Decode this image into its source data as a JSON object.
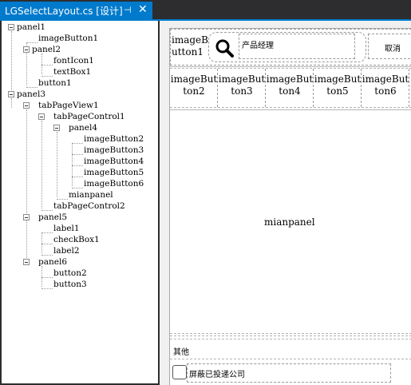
{
  "tab": {
    "title": "LGSelectLayout.cs [设计]",
    "pin_icon": "pin-icon",
    "close_icon": "close-icon"
  },
  "tree": {
    "panel1": "panel1",
    "imageButton1": "imageButton1",
    "panel2": "panel2",
    "fontIcon1": "fontIcon1",
    "textBox1": "textBox1",
    "button1": "button1",
    "panel3": "panel3",
    "tabPageView1": "tabPageView1",
    "tabPageControl1": "tabPageControl1",
    "panel4": "panel4",
    "imageButton2": "imageButton2",
    "imageButton3": "imageButton3",
    "imageButton4": "imageButton4",
    "imageButton5": "imageButton5",
    "imageButton6": "imageButton6",
    "mianpanel": "mianpanel",
    "tabPageControl2": "tabPageControl2",
    "panel5": "panel5",
    "label1": "label1",
    "checkBox1": "checkBox1",
    "label2": "label2",
    "panel6": "panel6",
    "button2": "button2",
    "button3": "button3"
  },
  "design": {
    "imageButton1_line1": "imageB",
    "imageButton1_line2": "utton1",
    "search_icon": "search-icon",
    "textbox_value": "产品经理",
    "button1_label": "取消",
    "tabs": [
      {
        "l1": "imageBut",
        "l2": "ton2"
      },
      {
        "l1": "imageBut",
        "l2": "ton3"
      },
      {
        "l1": "imageBut",
        "l2": "ton4"
      },
      {
        "l1": "imageBut",
        "l2": "ton5"
      },
      {
        "l1": "imageBut",
        "l2": "ton6"
      }
    ],
    "mianpanel_label": "mianpanel",
    "label1_text": "其他",
    "label2_text": "屏蔽已投递公司"
  }
}
